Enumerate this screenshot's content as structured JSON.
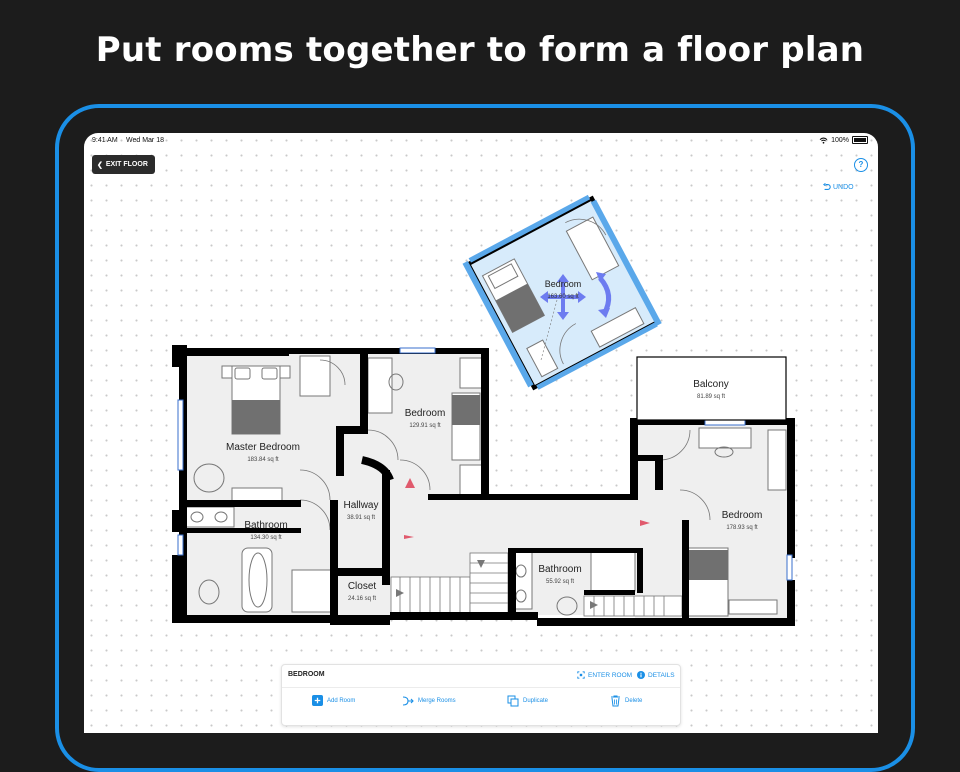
{
  "headline": "Put rooms together to form a floor plan",
  "status": {
    "time": "9:41 AM",
    "date": "Wed Mar 18",
    "battery": "100%"
  },
  "toolbar": {
    "exit": "EXIT FLOOR",
    "help": "?",
    "undo": "UNDO"
  },
  "rooms": [
    {
      "name": "Master Bedroom",
      "area": "183.84 sq ft"
    },
    {
      "name": "Bedroom",
      "area": "129.91 sq ft"
    },
    {
      "name": "Hallway",
      "area": "38.91 sq ft"
    },
    {
      "name": "Bathroom",
      "area": "134.30 sq ft"
    },
    {
      "name": "Closet",
      "area": "24.16 sq ft"
    },
    {
      "name": "Bathroom",
      "area": "55.92 sq ft"
    },
    {
      "name": "Balcony",
      "area": "81.89 sq ft"
    },
    {
      "name": "Bedroom",
      "area": "178.93 sq ft"
    },
    {
      "name": "Bedroom",
      "area": "163.60 sq ft"
    }
  ],
  "panel": {
    "title": "BEDROOM",
    "enter_room": "ENTER ROOM",
    "details": "DETAILS",
    "actions": [
      "Add Room",
      "Merge Rooms",
      "Duplicate",
      "Delete"
    ]
  },
  "colors": {
    "accent": "#1a8fe6",
    "room_fill": "#efefef",
    "selected_fill": "#d7ebfb"
  }
}
